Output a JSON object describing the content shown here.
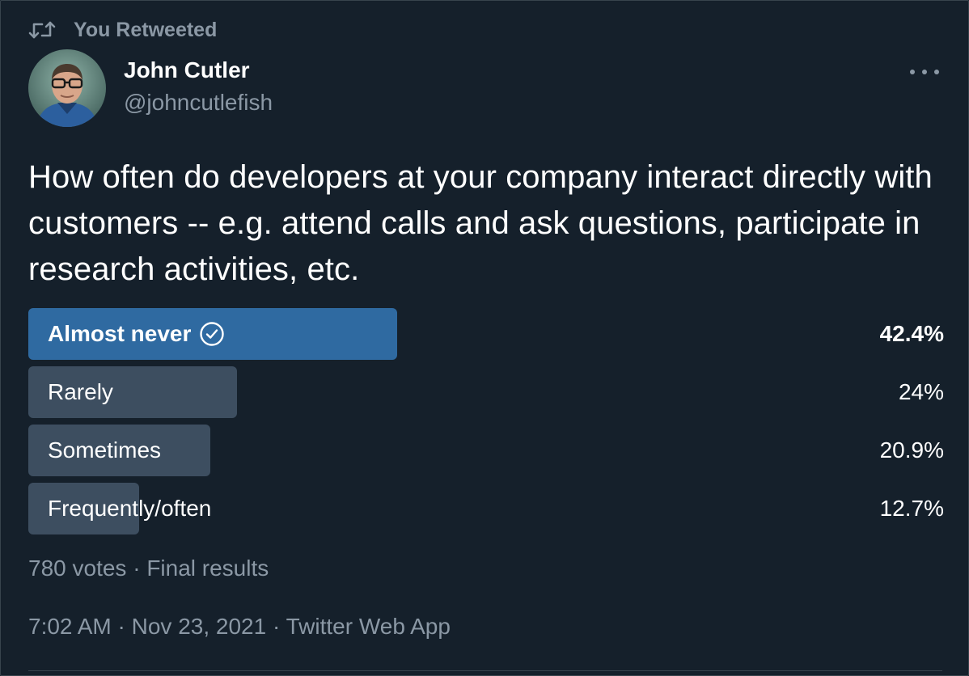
{
  "social_context": {
    "text": "You Retweeted",
    "icon": "retweet-icon"
  },
  "author": {
    "name": "John Cutler",
    "handle": "@johncutlefish",
    "avatar": "avatar-photo"
  },
  "more_icon": "more-horizontal-icon",
  "tweet": {
    "text": "How often do developers at your company interact directly with customers -- e.g. attend calls and ask questions, participate in research activities, etc."
  },
  "poll": {
    "options": [
      {
        "label": "Almost never",
        "percent_text": "42.4%",
        "percent": 42.4,
        "winner": true
      },
      {
        "label": "Rarely",
        "percent_text": "24%",
        "percent": 24,
        "winner": false
      },
      {
        "label": "Sometimes",
        "percent_text": "20.9%",
        "percent": 20.9,
        "winner": false
      },
      {
        "label": "Frequently/often",
        "percent_text": "12.7%",
        "percent": 12.7,
        "winner": false
      }
    ],
    "votes": "780 votes",
    "separator": "·",
    "status": "Final results"
  },
  "meta": {
    "time": "7:02 AM",
    "separator": "·",
    "date": "Nov 23, 2021",
    "source": "Twitter Web App"
  },
  "colors": {
    "background": "#15202b",
    "winner_bar": "#2f6aa1",
    "other_bar": "#3d4e60",
    "secondary_text": "#8b98a5"
  }
}
